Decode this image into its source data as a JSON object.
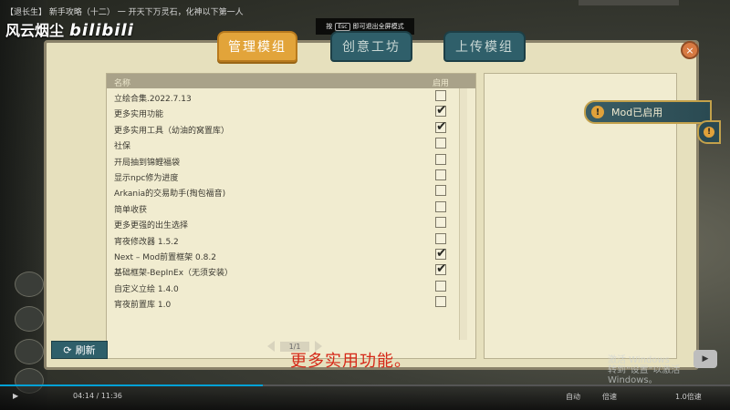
{
  "video": {
    "title": "【退长生】 新手攻略（十二） 一   开天下万灵石，化神以下第一人",
    "brand": "风云烟尘",
    "brand_logo": "bilibili",
    "esc_key": "Esc",
    "esc_hint_prefix": "按",
    "esc_hint_suffix": "即可退出全屏模式",
    "subtitle": "更多实用功能。",
    "time": "04:14 / 11:36",
    "windows_watermark_1": "激活 Windows",
    "windows_watermark_2": "转到\"设置\"以激活 Windows。",
    "controls": [
      "自动",
      "倍速",
      "1.0倍速"
    ],
    "progress": 0.36
  },
  "tabs": [
    {
      "label": "管理模组",
      "active": true
    },
    {
      "label": "创意工坊",
      "active": false
    },
    {
      "label": "上传模组",
      "active": false
    }
  ],
  "list": {
    "header_name": "名称",
    "header_enable": "启用",
    "pager": "1/1",
    "items": [
      {
        "name": "立绘合集.2022.7.13",
        "enabled": false
      },
      {
        "name": "更多实用功能",
        "enabled": true
      },
      {
        "name": "更多实用工具（幼油的窝置库）",
        "enabled": true
      },
      {
        "name": "社保",
        "enabled": false
      },
      {
        "name": "开局抽到锦鲤福袋",
        "enabled": false
      },
      {
        "name": "显示npc修为进度",
        "enabled": false
      },
      {
        "name": "Arkania的交易助手(掏包福音)",
        "enabled": false
      },
      {
        "name": "简单收获",
        "enabled": false
      },
      {
        "name": "更多更强的出生选择",
        "enabled": false
      },
      {
        "name": "宵夜修改器 1.5.2",
        "enabled": false
      },
      {
        "name": "Next – Mod前置框架 0.8.2",
        "enabled": true
      },
      {
        "name": "基础框架-BepInEx（无须安装）",
        "enabled": true
      },
      {
        "name": "自定义立绘 1.4.0",
        "enabled": false
      },
      {
        "name": "宵夜前置库 1.0",
        "enabled": false
      }
    ]
  },
  "refresh_label": "刷新",
  "notice": {
    "text": "Mod已启用",
    "icon": "exclamation-icon"
  },
  "close_symbol": "×",
  "colors": {
    "active_tab": "#e2a43a",
    "inactive_tab": "#2f5f6a",
    "panel": "#e6e0bd",
    "subtitle": "#d52818"
  }
}
